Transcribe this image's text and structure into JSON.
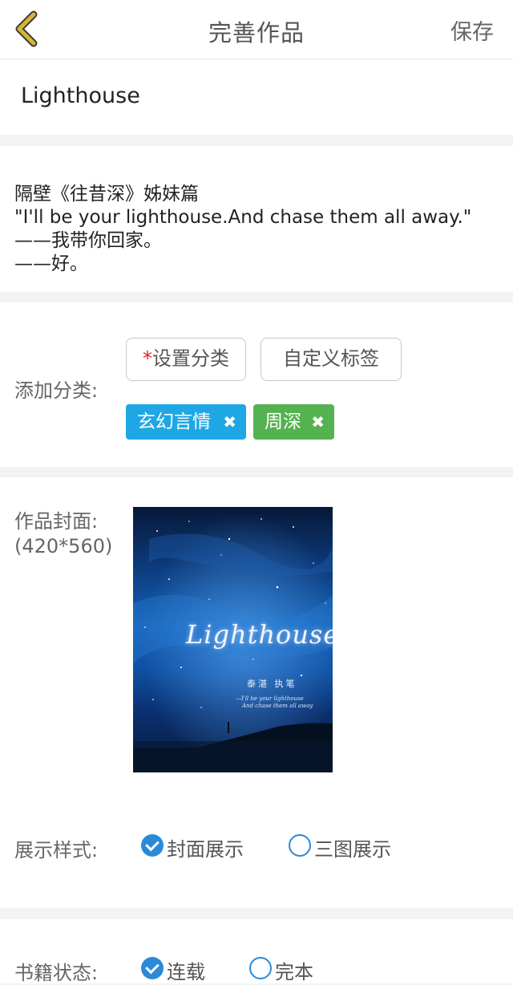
{
  "header": {
    "title": "完善作品",
    "save_label": "保存"
  },
  "work": {
    "title": "Lighthouse",
    "description_lines": [
      "隔壁《往昔深》姊妹篇",
      "\"I'll be your lighthouse.And chase them all away.\"",
      "——我带你回家。",
      "——好。"
    ]
  },
  "category": {
    "label": "添加分类:",
    "set_category_required": "*",
    "set_category_label": "设置分类",
    "custom_tag_label": "自定义标签",
    "tags": [
      {
        "label": "玄幻言情",
        "color": "#1ea7e4"
      },
      {
        "label": "周深",
        "color": "#55b250"
      }
    ],
    "tag_remove_symbol": "✖"
  },
  "cover": {
    "label": "作品封面:",
    "size_hint": "(420*560)",
    "image_title": "Lighthouse",
    "image_author": "泰湛 执笔",
    "image_subtitle_lines": [
      "—I'll be your lighthouse",
      "And chase them all away"
    ]
  },
  "display_style": {
    "label": "展示样式:",
    "options": [
      {
        "label": "封面展示",
        "selected": true
      },
      {
        "label": "三图展示",
        "selected": false
      }
    ]
  },
  "book_status": {
    "label": "书籍状态:",
    "options": [
      {
        "label": "连载",
        "selected": true
      },
      {
        "label": "完本",
        "selected": false
      }
    ]
  },
  "colors": {
    "accent_blue": "#2b8ad8",
    "back_arrow": "#c9a227",
    "tag_blue": "#1ea7e4",
    "tag_green": "#55b250",
    "required_star": "#e02020"
  },
  "icons": [
    "back-arrow-icon",
    "tag-remove-icon",
    "radio-checked-icon",
    "radio-unchecked-icon"
  ]
}
